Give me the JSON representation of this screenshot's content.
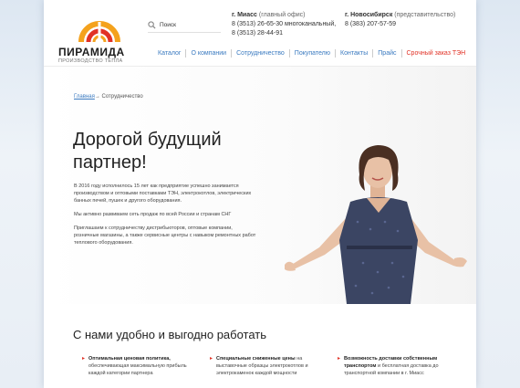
{
  "logo": {
    "title": "ПИРАМИДА",
    "subtitle": "ПРОИЗВОДСТВО ТЕПЛА",
    "colors": {
      "arc_outer": "#f4a21d",
      "arc_inner": "#e13226"
    }
  },
  "search": {
    "placeholder": "Поиск",
    "icon": "search-icon"
  },
  "contacts": [
    {
      "city": "г. Миасс",
      "note": "(главный офис)",
      "phone1": "8 (3513) 26-65-30 многоканальный,",
      "phone2": "8 (3513) 28-44-91"
    },
    {
      "city": "г. Новосибирск",
      "note": "(представительство)",
      "phone1": "8 (383) 207-57-59"
    }
  ],
  "nav": [
    {
      "label": "Каталог"
    },
    {
      "label": "О компании"
    },
    {
      "label": "Сотрудничество"
    },
    {
      "label": "Покупателю"
    },
    {
      "label": "Контакты"
    },
    {
      "label": "Прайс"
    },
    {
      "label": "Срочный заказ ТЭН"
    }
  ],
  "breadcrumb": {
    "home": "Главная",
    "separator": "→",
    "current": "Сотрудничество"
  },
  "hero": {
    "title_line1": "Дорогой будущий",
    "title_line2": "партнер!",
    "paragraphs": [
      "В 2016 году исполнилось 15 лет как предприятие успешно занимается производством и оптовыми поставками ТЭН, электрокотлов, электрических банных печей, пушек и другого оборудования.",
      "Мы активно развиваем сеть продаж по всей России и странам СНГ",
      "Приглашаем к сотрудничеству дистрибьюторов, оптовые компании, розничные магазины, а также сервисные центры с навыком ремонтных работ теплового оборудования."
    ]
  },
  "benefits": {
    "title": "С нами удобно и выгодно работать",
    "items": [
      {
        "title": "Оптимальная ценовая политика,",
        "text": "обеспечивающая максимальную прибыль каждой категории партнера"
      },
      {
        "title": "Специальные сниженные цены",
        "text": "на выставочные образцы электрокотлов и электрокаменок каждой мощности"
      },
      {
        "title": "Возможность доставки собственным транспортом",
        "text": "и бесплатная доставка до транспортной компании в г. Миасс"
      }
    ]
  },
  "colors": {
    "link": "#3a7ac0",
    "accent": "#e13226",
    "dress": "#3b4563"
  }
}
